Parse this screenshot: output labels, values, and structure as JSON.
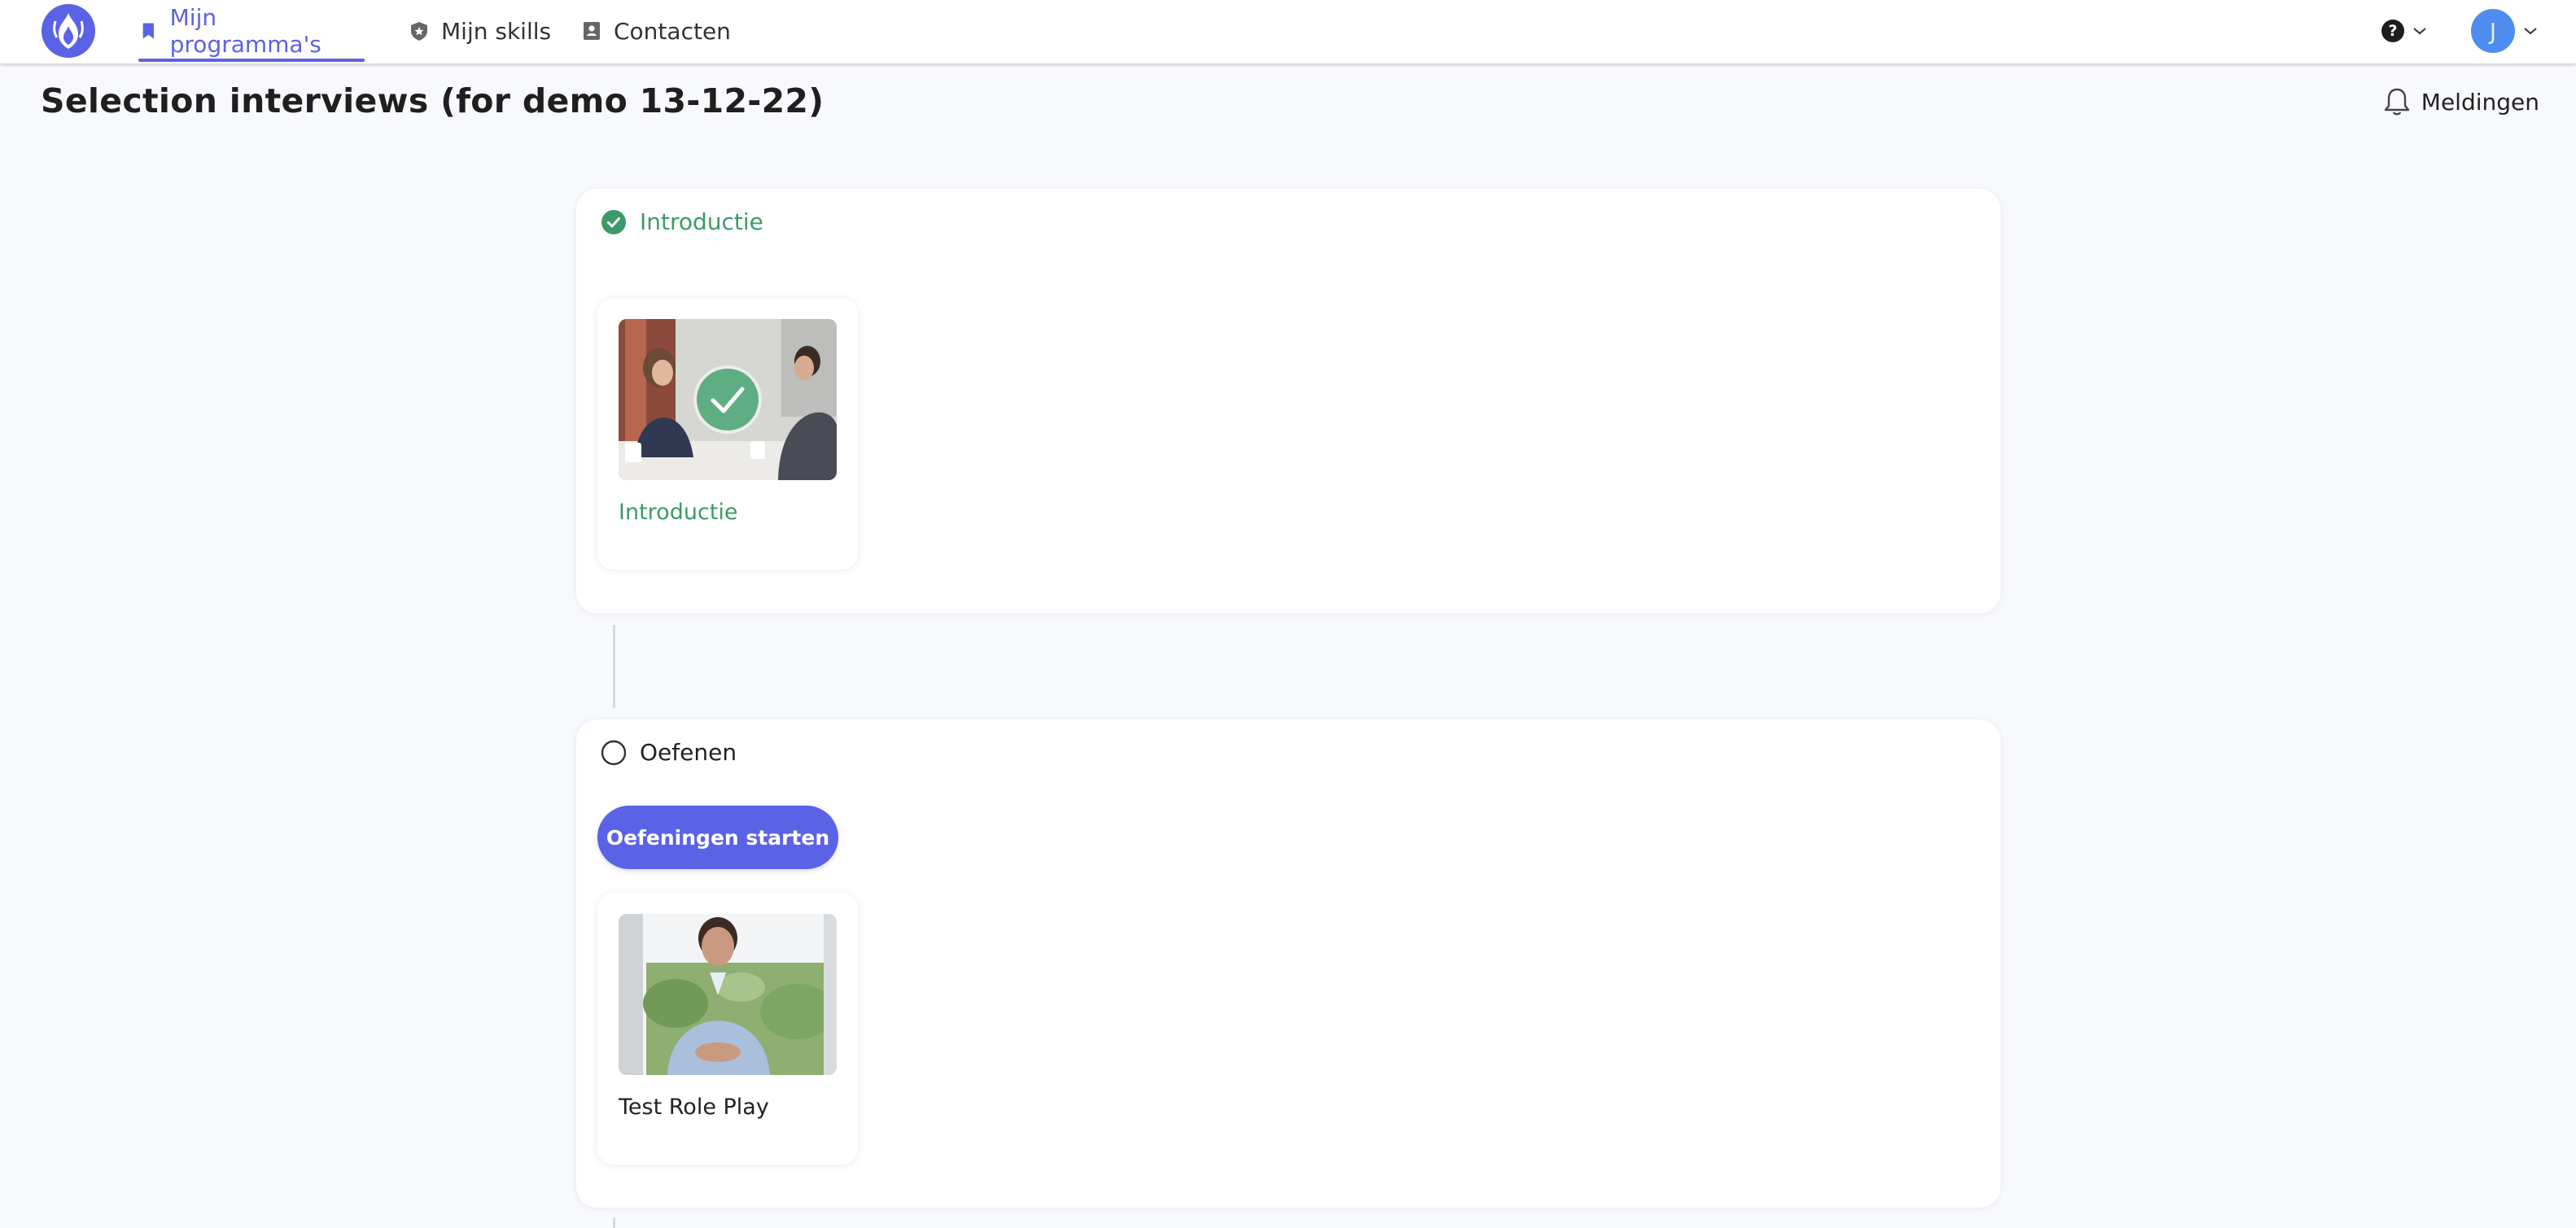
{
  "nav": {
    "items": [
      {
        "label": "Mijn programma's",
        "icon": "bookmark-icon",
        "active": true
      },
      {
        "label": "Mijn skills",
        "icon": "shield-icon",
        "active": false
      },
      {
        "label": "Contacten",
        "icon": "contact-book-icon",
        "active": false
      }
    ],
    "user_initial": "J"
  },
  "page": {
    "title": "Selection interviews (for demo 13-12-22)",
    "notifications_label": "Meldingen"
  },
  "sections": [
    {
      "title": "Introductie",
      "status": "completed",
      "card": {
        "title": "Introductie",
        "completed": true
      }
    },
    {
      "title": "Oefenen",
      "status": "not-started",
      "button_label": "Oefeningen starten",
      "card": {
        "title": "Test Role Play",
        "completed": false
      }
    }
  ],
  "colors": {
    "accent": "#5a62e6",
    "success": "#3c9a6a",
    "avatar": "#4f8cf0",
    "background": "#f8f9fd"
  }
}
